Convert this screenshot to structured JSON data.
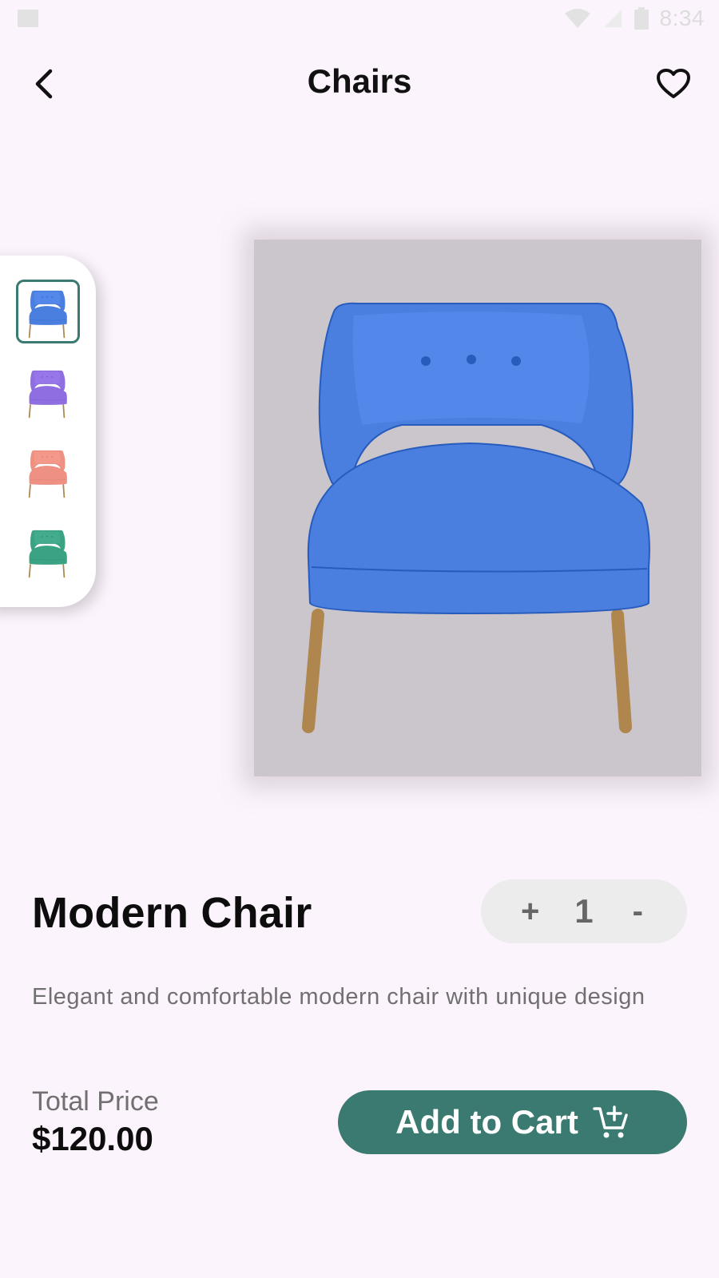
{
  "status_bar": {
    "time": "8:34",
    "icons": [
      "image-icon",
      "wifi-icon",
      "signal-icon",
      "battery-icon"
    ]
  },
  "app_bar": {
    "title": "Chairs",
    "back_icon": "chevron-left-icon",
    "favorite_icon": "heart-outline-icon"
  },
  "gallery": {
    "thumbnails": [
      {
        "color": "#4a7fe0",
        "selected": true
      },
      {
        "color": "#8e6ee0",
        "selected": false
      },
      {
        "color": "#ee9182",
        "selected": false
      },
      {
        "color": "#3aa384",
        "selected": false
      }
    ],
    "main_color": "#4a7fe0",
    "leg_color": "#b0864f"
  },
  "product": {
    "name": "Modern Chair",
    "description": "Elegant and comfortable modern chair with unique design",
    "quantity": {
      "plus_label": "+",
      "value": "1",
      "minus_label": "-"
    }
  },
  "footer": {
    "price_label": "Total Price",
    "price_value": "$120.00",
    "add_to_cart_label": "Add to Cart",
    "cart_icon": "add-shopping-cart-icon"
  },
  "colors": {
    "accent": "#3b7a70",
    "background": "#fcf4fc"
  }
}
